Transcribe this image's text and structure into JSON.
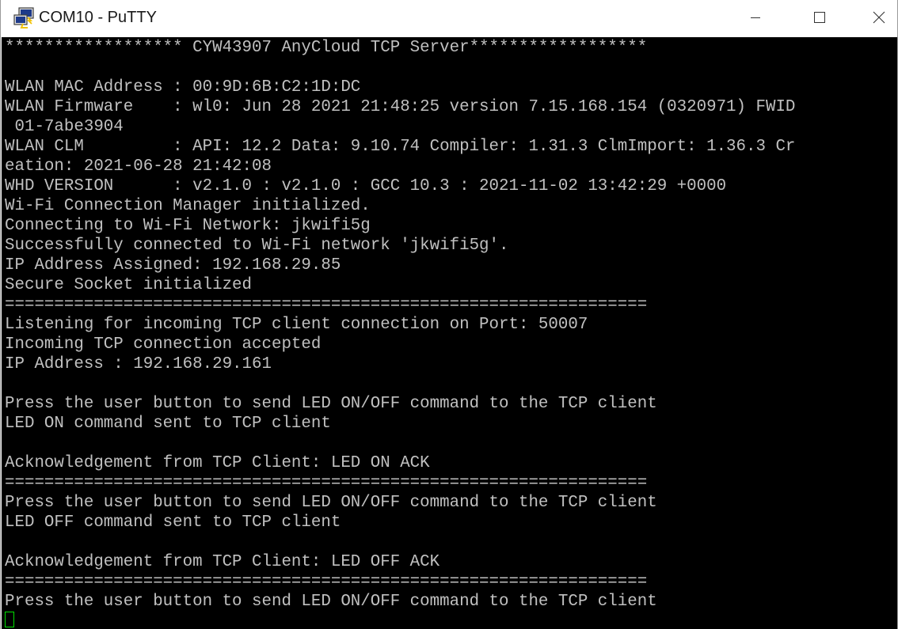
{
  "window": {
    "title": "COM10 - PuTTY",
    "icons": {
      "app": "putty-computer-icon",
      "minimize": "minimize-icon",
      "maximize": "maximize-icon",
      "close": "close-icon"
    },
    "colors": {
      "terminal_background": "#000000",
      "terminal_text": "#c0c0c0",
      "cursor": "#00e000",
      "titlebar": "#ffffff"
    }
  },
  "terminal": {
    "lines": [
      "****************** CYW43907 AnyCloud TCP Server******************",
      "",
      "WLAN MAC Address : 00:9D:6B:C2:1D:DC",
      "WLAN Firmware    : wl0: Jun 28 2021 21:48:25 version 7.15.168.154 (0320971) FWID",
      " 01-7abe3904",
      "WLAN CLM         : API: 12.2 Data: 9.10.74 Compiler: 1.31.3 ClmImport: 1.36.3 Cr",
      "eation: 2021-06-28 21:42:08",
      "WHD VERSION      : v2.1.0 : v2.1.0 : GCC 10.3 : 2021-11-02 13:42:29 +0000",
      "Wi-Fi Connection Manager initialized.",
      "Connecting to Wi-Fi Network: jkwifi5g",
      "Successfully connected to Wi-Fi network 'jkwifi5g'.",
      "IP Address Assigned: 192.168.29.85",
      "Secure Socket initialized",
      "=================================================================",
      "Listening for incoming TCP client connection on Port: 50007",
      "Incoming TCP connection accepted",
      "IP Address : 192.168.29.161",
      "",
      "Press the user button to send LED ON/OFF command to the TCP client",
      "LED ON command sent to TCP client",
      "",
      "Acknowledgement from TCP Client: LED ON ACK",
      "=================================================================",
      "Press the user button to send LED ON/OFF command to the TCP client",
      "LED OFF command sent to TCP client",
      "",
      "Acknowledgement from TCP Client: LED OFF ACK",
      "=================================================================",
      "Press the user button to send LED ON/OFF command to the TCP client"
    ]
  }
}
